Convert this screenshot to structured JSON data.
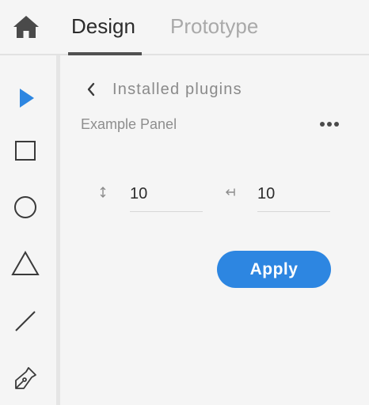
{
  "header": {
    "home_icon": "home-icon",
    "tabs": [
      {
        "label": "Design",
        "active": true
      },
      {
        "label": "Prototype",
        "active": false
      }
    ]
  },
  "toolbar": {
    "tools": [
      {
        "icon": "select-arrow-icon",
        "active": true,
        "color": "#2d86e1"
      },
      {
        "icon": "rectangle-icon",
        "active": false
      },
      {
        "icon": "ellipse-icon",
        "active": false
      },
      {
        "icon": "triangle-icon",
        "active": false
      },
      {
        "icon": "line-icon",
        "active": false
      },
      {
        "icon": "pen-icon",
        "active": false
      }
    ]
  },
  "panel": {
    "back_icon": "chevron-left-icon",
    "breadcrumb": "Installed plugins",
    "title": "Example Panel",
    "more_icon": "more-horizontal-icon",
    "fields": [
      {
        "icon": "vertical-resize-icon",
        "value": "10"
      },
      {
        "icon": "arrow-left-icon",
        "value": "10"
      }
    ],
    "apply_label": "Apply"
  },
  "colors": {
    "accent": "#2d86e1",
    "background": "#f5f5f5",
    "text_primary": "#2c2c2c",
    "text_secondary": "#8a8a8a"
  }
}
